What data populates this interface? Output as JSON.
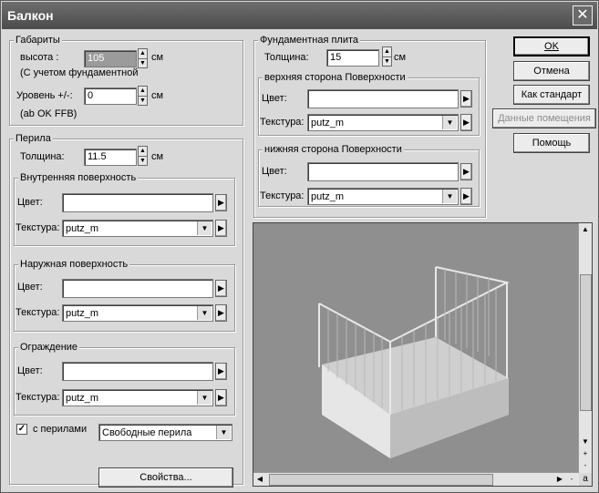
{
  "window": {
    "title": "Балкон",
    "close_symbol": "✕"
  },
  "dimensions": {
    "group_title": "Габариты",
    "height_label": "высота :",
    "height_value": "105",
    "height_unit": "см",
    "height_note": "(С учетом фундаментной",
    "level_label": "Уровень +/-:",
    "level_value": "0",
    "level_unit": "см",
    "level_note": "(ab OK FFB)"
  },
  "railing": {
    "group_title": "Перила",
    "thickness_label": "Толщина:",
    "thickness_value": "11.5",
    "thickness_unit": "см",
    "inner": {
      "title": "Внутренняя поверхность",
      "color_label": "Цвет:",
      "texture_label": "Текстура:",
      "texture_value": "putz_m"
    },
    "outer": {
      "title": "Наружная поверхность",
      "color_label": "Цвет:",
      "texture_label": "Текстура:",
      "texture_value": "putz_m"
    },
    "fence": {
      "title": "Ограждение",
      "color_label": "Цвет:",
      "texture_label": "Текстура:",
      "texture_value": "putz_m"
    },
    "with_railing_label": "с перилами",
    "with_railing_checked": true,
    "railing_type_value": "Свободные перила",
    "properties_button": "Свойства..."
  },
  "foundation": {
    "group_title": "Фундаментная плита",
    "thickness_label": "Толщина:",
    "thickness_value": "15",
    "thickness_unit": "см",
    "top": {
      "title": "верхняя сторона Поверхности",
      "color_label": "Цвет:",
      "texture_label": "Текстура:",
      "texture_value": "putz_m"
    },
    "bottom": {
      "title": "нижняя сторона Поверхности",
      "color_label": "Цвет:",
      "texture_label": "Текстура:",
      "texture_value": "putz_m"
    }
  },
  "buttons": {
    "ok": "OK",
    "cancel": "Отмена",
    "as_standard": "Как стандарт",
    "room_data": "Данные помещения",
    "help": "Помощь"
  },
  "preview": {
    "zoom_in": "+",
    "zoom_out": "-",
    "angle": "a"
  },
  "colors": {
    "titlebar": "#555555",
    "dialog": "#d9d9d9",
    "preview_bg": "#8f8f8f"
  }
}
